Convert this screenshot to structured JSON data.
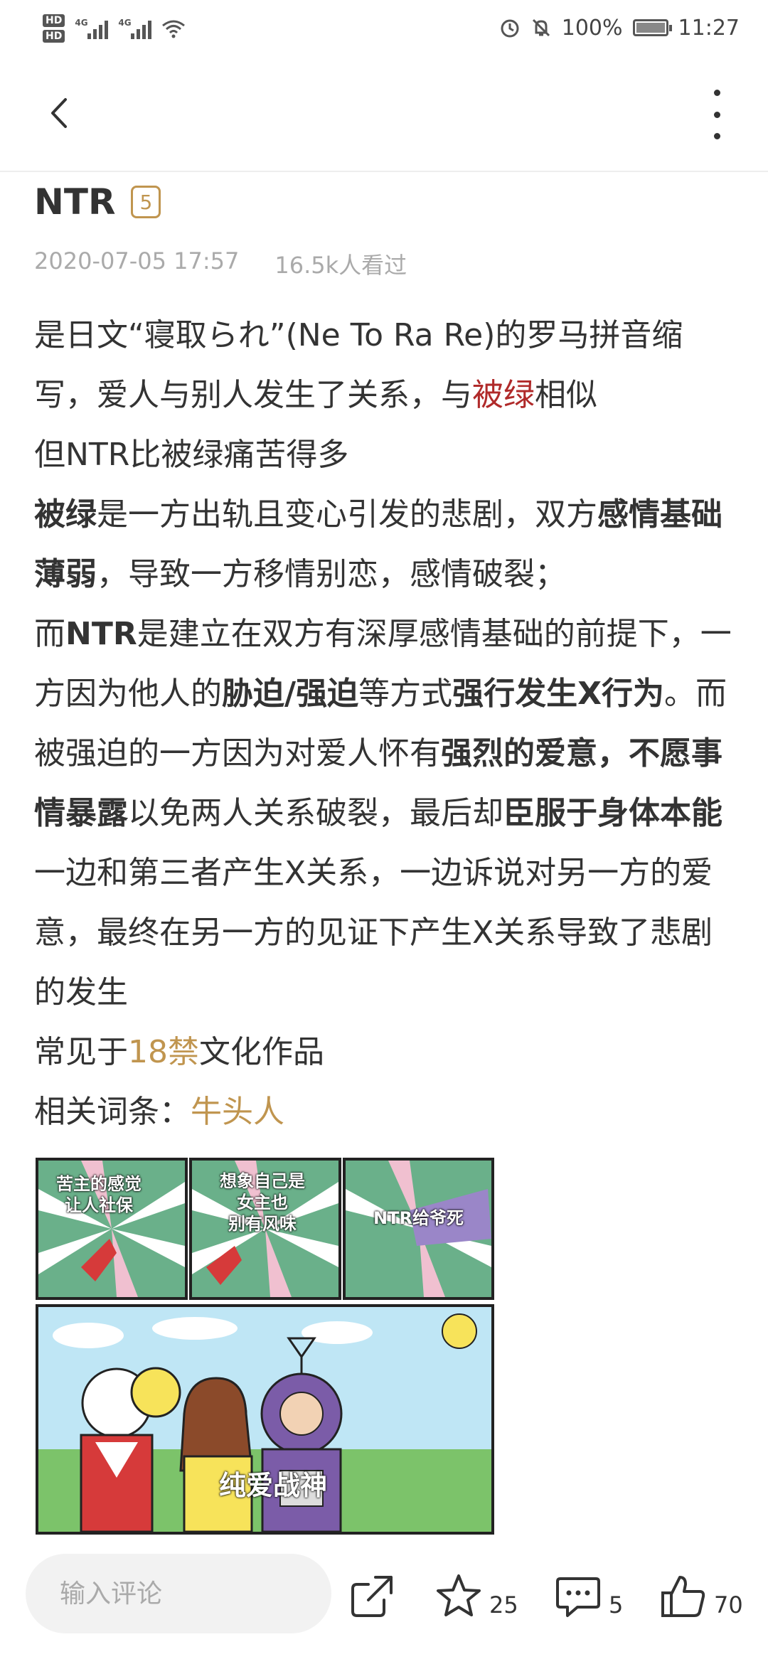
{
  "status_bar": {
    "hd1": "HD",
    "hd2": "HD",
    "net1": "4G",
    "net2": "4G",
    "battery": "100%",
    "time": "11:27"
  },
  "nav": {
    "back_icon": "chevron-left-icon",
    "more_icon": "more-vertical-icon"
  },
  "article": {
    "title": "NTR",
    "level": "5",
    "date": "2020-07-05 17:57",
    "views": "16.5k人看过",
    "p1_a": "是日文“寝取られ”(Ne To Ra Re)的罗马拼音缩写，爱人与别人发生了关系，与",
    "p1_link": "被绿",
    "p1_b": "相似",
    "p2": "但NTR比被绿痛苦得多",
    "p3_b1": "被绿",
    "p3_t1": "是一方出轨且变心引发的悲剧，双方",
    "p3_b2": "感情基础薄弱",
    "p3_t2": "，导致一方移情别恋，感情破裂；",
    "p4_t1": "而",
    "p4_b1": "NTR",
    "p4_t2": "是建立在双方有深厚感情基础的前提下，一方因为他人的",
    "p4_b2": "胁迫/强迫",
    "p4_t3": "等方式",
    "p4_b3": "强行发生X行为",
    "p4_t4": "。而被强迫的一方因为对爱人怀有",
    "p4_b4": "强烈的爱意，不愿事情暴露",
    "p4_t5": "以免两人关系破裂，最后却",
    "p4_b5": "臣服于身体本能",
    "p4_t6": "一边和第三者产生X关系，一边诉说对另一方的爱意，最终在另一方的见证下产生X关系导致了悲剧的发生",
    "p5_a": "常见于",
    "p5_link": "18禁",
    "p5_b": "文化作品",
    "p6_a": "相关词条：",
    "p6_link": "牛头人",
    "colors": {
      "link_red": "#b02a2a",
      "link_gold": "#c0954f"
    }
  },
  "comic": {
    "caption1": "苦主的感觉\n让人社保",
    "caption2": "想象自己是\n女主也\n别有风味",
    "caption3": "NTR给爷死",
    "caption4": "纯爱战神"
  },
  "bottom_bar": {
    "comment_placeholder": "输入评论",
    "share_icon": "share-icon",
    "star_icon": "star-icon",
    "star_count": "25",
    "comment_icon": "comment-icon",
    "comment_count": "5",
    "like_icon": "thumbs-up-icon",
    "like_count": "70"
  }
}
